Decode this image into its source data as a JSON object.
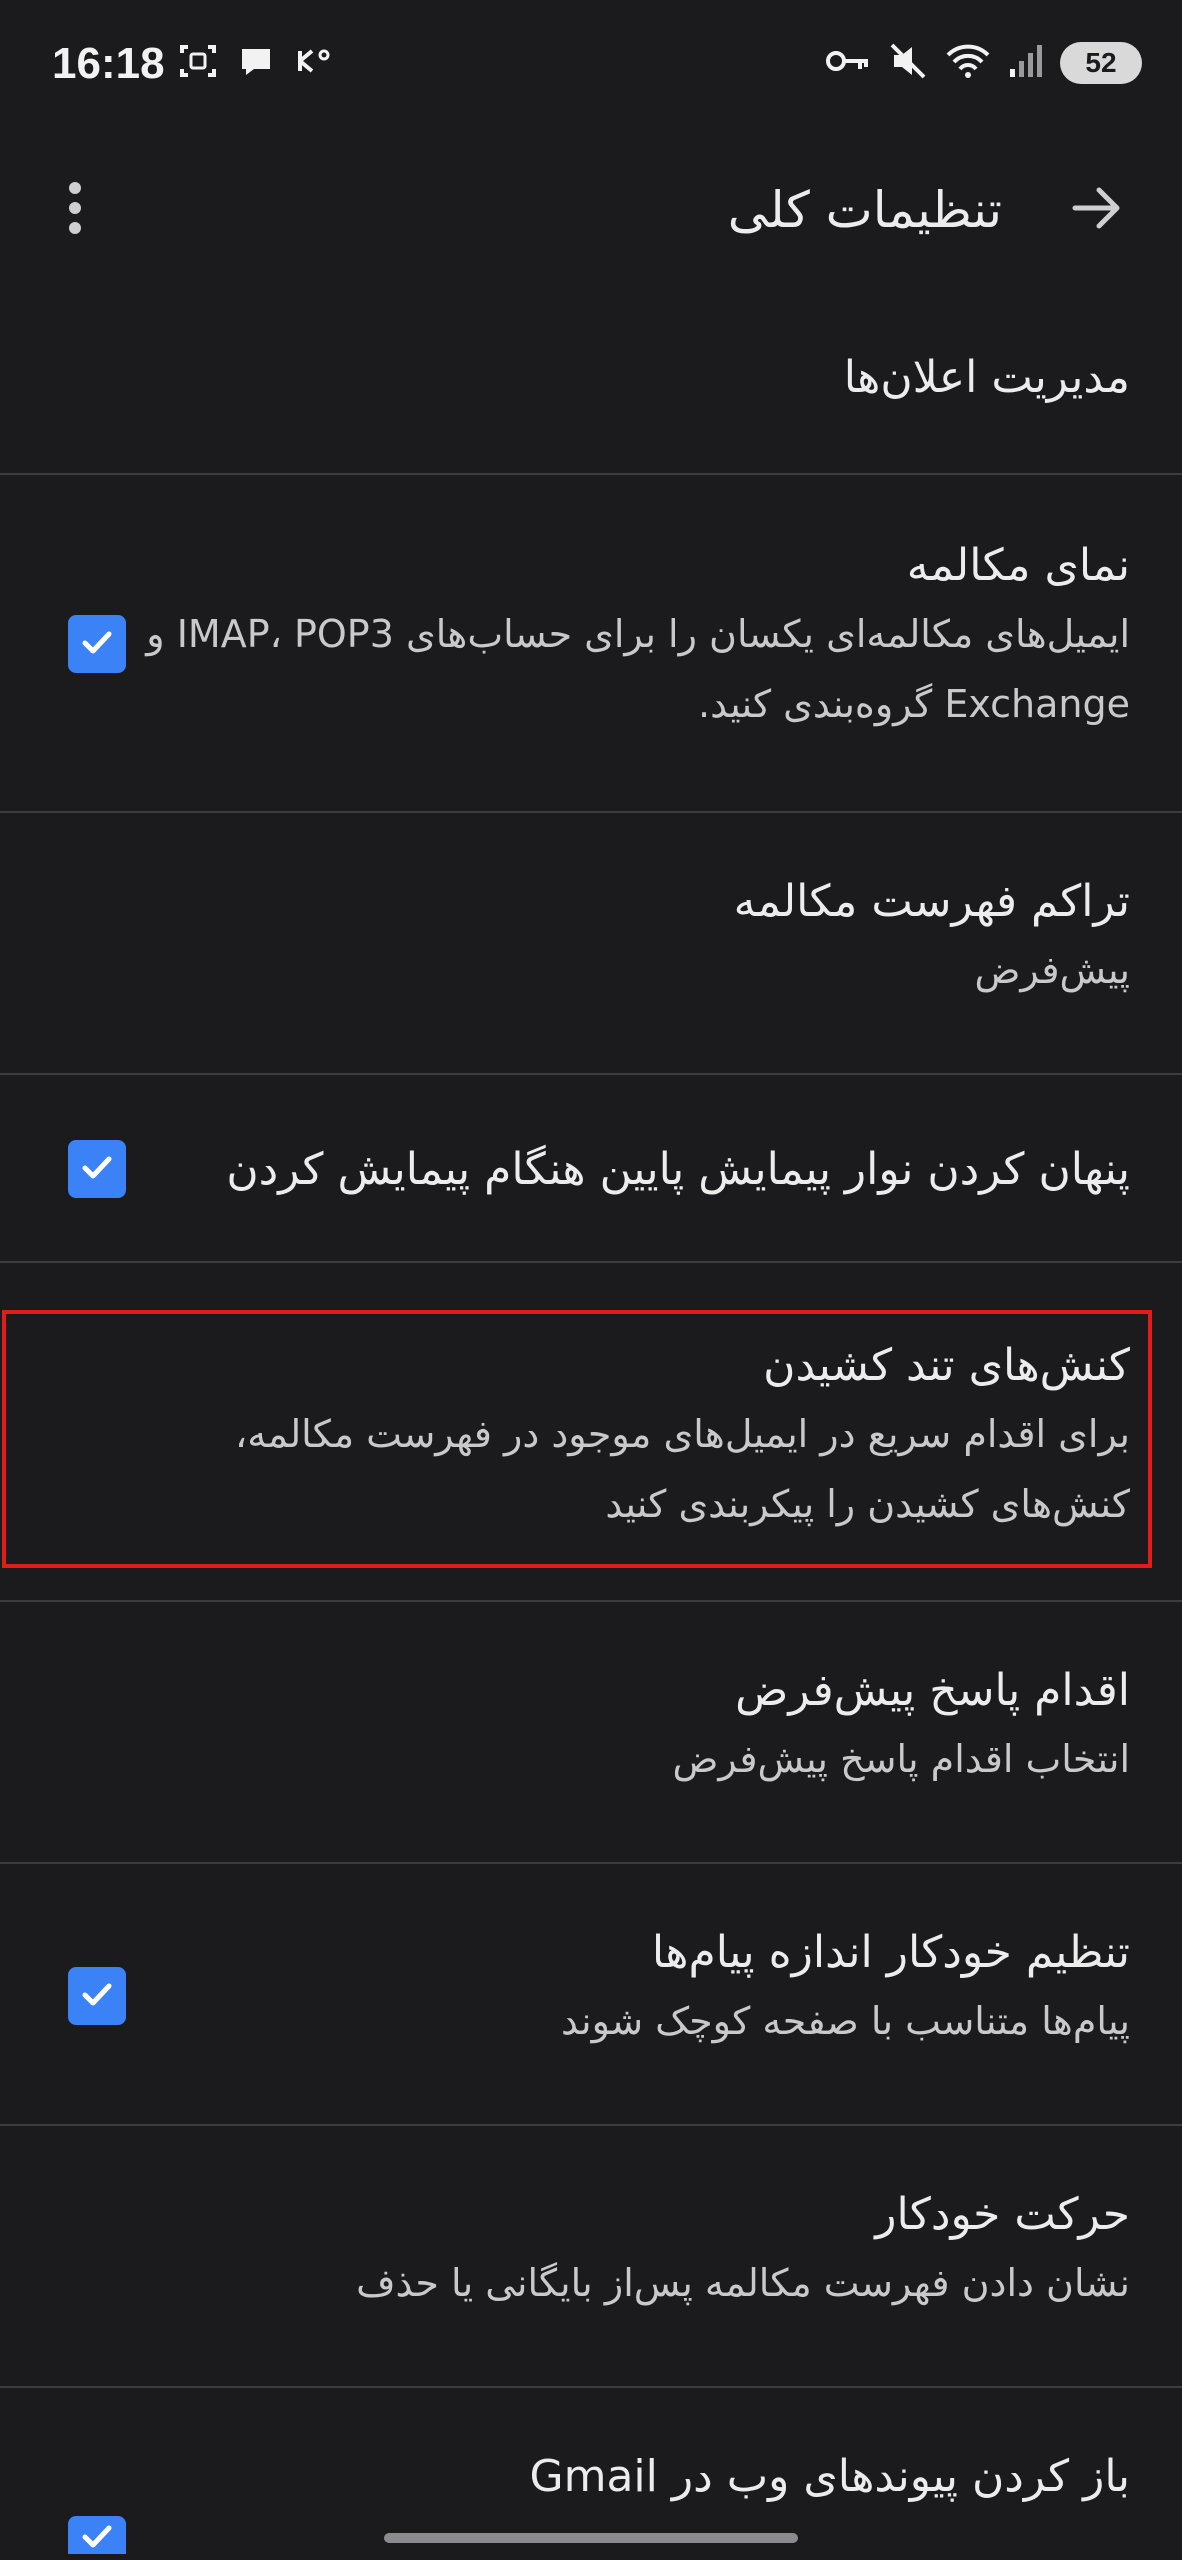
{
  "status_bar": {
    "time": "16:18",
    "battery": "52",
    "icons": [
      "screenshot-icon",
      "chat-icon",
      "data-speed-icon",
      "key-icon",
      "mute-vibrate-icon",
      "wifi-icon",
      "signal-icon"
    ]
  },
  "app_bar": {
    "title": "تنظیمات کلی",
    "back_icon": "arrow-back-icon",
    "more_icon": "more-vert-icon"
  },
  "settings": {
    "notifications": {
      "title": "مدیریت اعلان‌ها"
    },
    "conversation_view": {
      "title": "نمای مکالمه",
      "summary": "ایمیل‌های مکالمه‌ای یکسان را برای حساب‌های IMAP، POP3 و Exchange گروه‌بندی کنید.",
      "checked": true
    },
    "list_density": {
      "title": "تراکم فهرست مکالمه",
      "summary": "پیش‌فرض"
    },
    "hide_bottom_bar": {
      "title": "پنهان کردن نوار پیمایش پایین هنگام پیمایش کردن",
      "checked": true
    },
    "swipe_actions": {
      "title": "کنش‌های تند کشیدن",
      "summary": "برای اقدام سریع در ایمیل‌های موجود در فهرست مکالمه، کنش‌های کشیدن را پیکربندی کنید",
      "highlighted": true
    },
    "default_reply": {
      "title": "اقدام پاسخ پیش‌فرض",
      "summary": "انتخاب اقدام پاسخ پیش‌فرض"
    },
    "auto_fit": {
      "title": "تنظیم خودکار اندازه پیام‌ها",
      "summary": "پیام‌ها متناسب با صفحه کوچک شوند",
      "checked": true
    },
    "auto_advance": {
      "title": "حرکت خودکار",
      "summary": "نشان دادن فهرست مکالمه پس‌از بایگانی یا حذف"
    },
    "open_links": {
      "title": "باز کردن پیوندهای وب در Gmail",
      "checked": true
    }
  },
  "colors": {
    "background": "#1b1b1d",
    "divider": "#3c3c40",
    "accent": "#3b82f6",
    "highlight": "#e21b1b"
  }
}
